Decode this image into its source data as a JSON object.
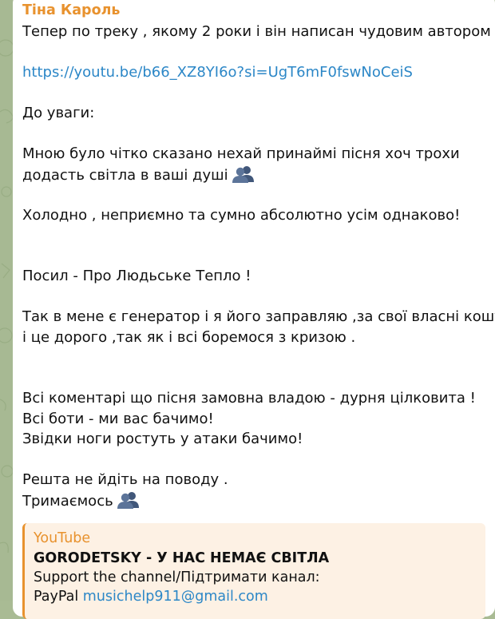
{
  "message": {
    "sender": "Тіна Кароль",
    "lines": [
      "Тепер по треку , якому 2 роки і він написан чудовим автором !",
      "",
      "https://youtu.be/b66_XZ8YI6o?si=UgT6mF0fswNoCeiS",
      "",
      "До уваги:",
      "",
      "Мною було чітко сказано нехай принаймі пісня хоч  трохи",
      "додасть світла в ваші душі",
      "",
      "Холодно , неприємно та сумно абсолютно усім однаково!",
      "",
      "",
      "Посил - Про Людьське Тепло !",
      "",
      "Так в мене є генератор і я його заправляю ,за свої власні кошти",
      "і це дорого ,так  як і всі   боремося з кризою .",
      "",
      "",
      "Всі коментарі що пісня замовна владою - дурня цілковита !",
      "Всі боти - ми вас бачимо!",
      "Звідки ноги ростуть у атаки бачимо!",
      "",
      "Решта не йдіть на поводу .",
      "Тримаємось"
    ],
    "emoji_name": "busts-in-silhouette-icon"
  },
  "preview": {
    "site": "YouTube",
    "title": "GORODETSKY - У НАС НЕМАЄ СВІТЛА",
    "desc_line1": "Support the channel/Підтримати канал:",
    "desc_line2_prefix": "PayPal ",
    "desc_line2_link": "musichelp911@gmail.com"
  },
  "colors": {
    "sender": "#e8922e",
    "link": "#2c87c7",
    "preview_bg": "#fdf1e4",
    "chat_bg": "#a9bb94"
  }
}
